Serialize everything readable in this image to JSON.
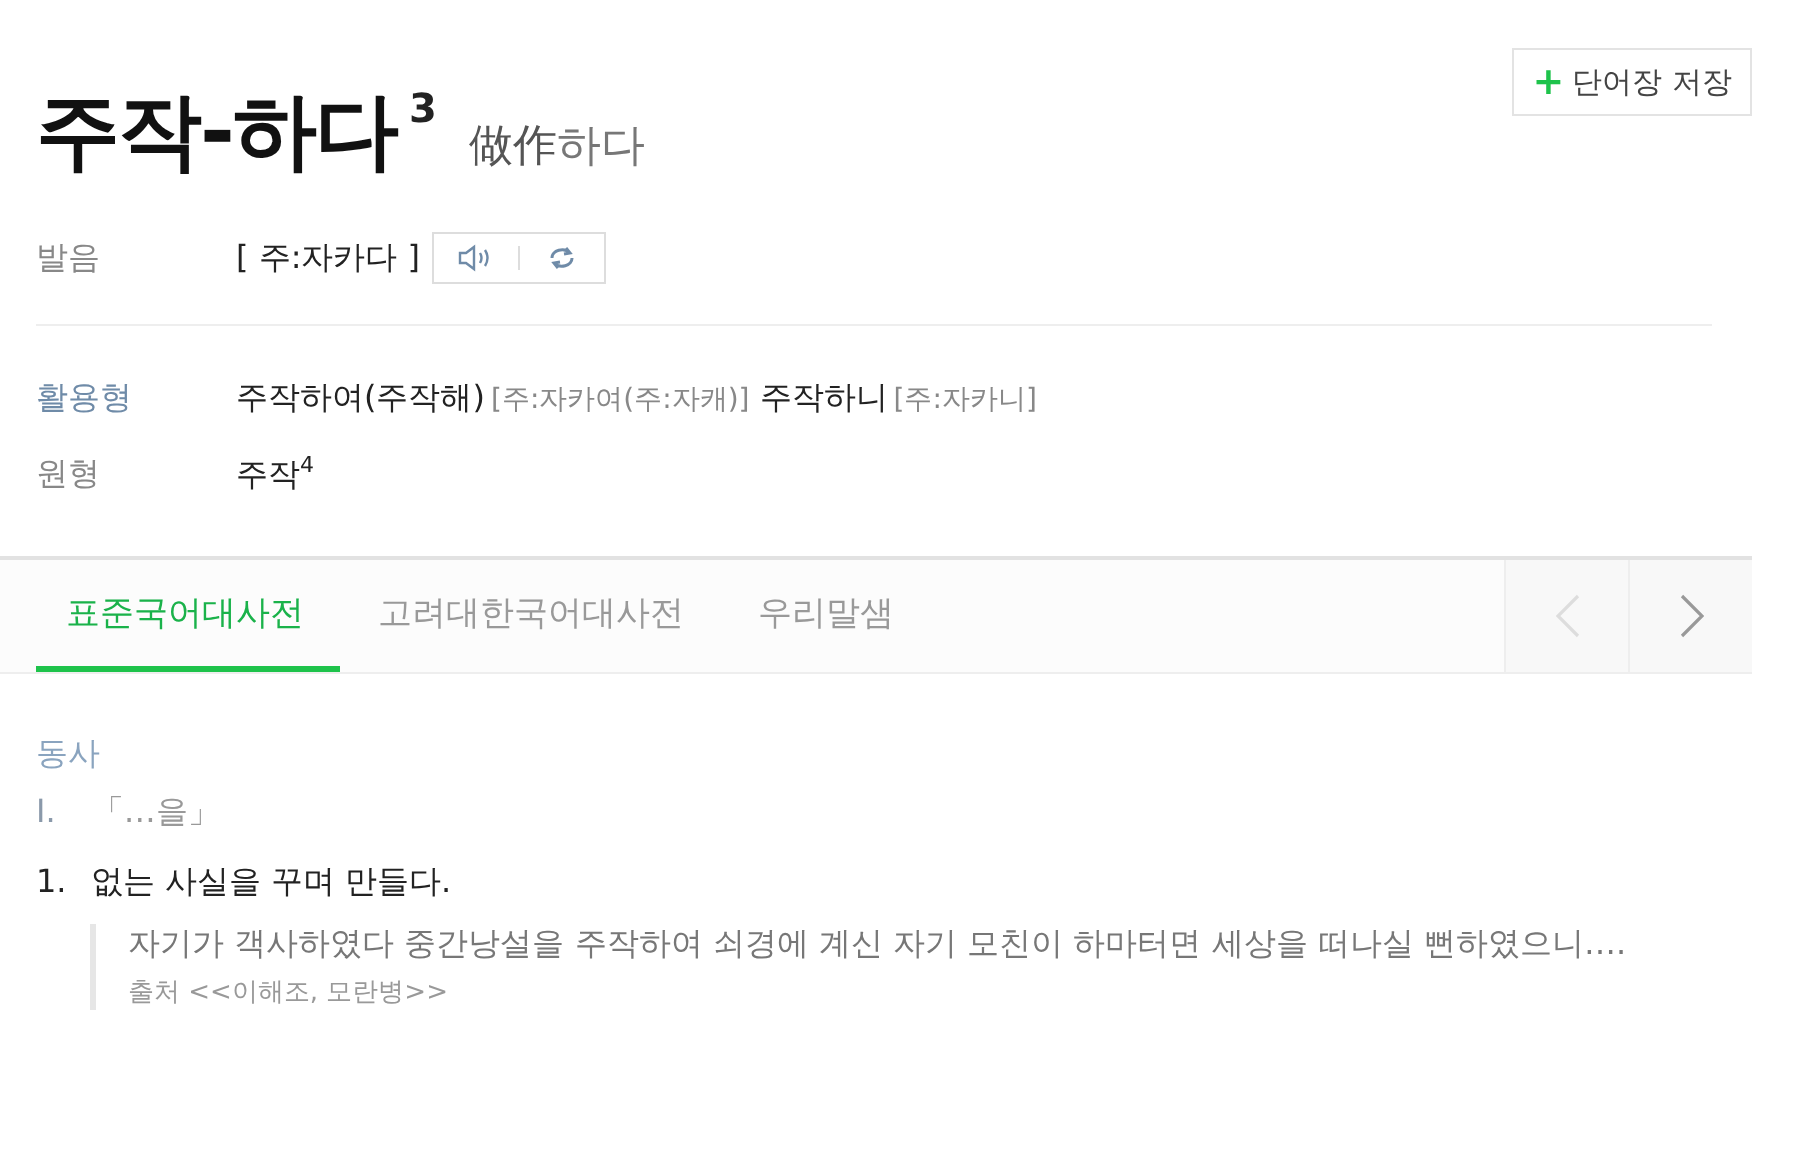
{
  "save_button": {
    "icon": "+",
    "label": "단어장 저장"
  },
  "headword": {
    "word": "주작-하다",
    "homograph": "3",
    "origin": {
      "hanja": "做作",
      "native": "하다"
    }
  },
  "pronunciation": {
    "label": "발음",
    "text": "[ 주:자카다 ]"
  },
  "inflections": {
    "label": "활용형",
    "items": [
      {
        "form": "주작하여(주작해)",
        "pron": "[주:자카여(주:자캐)]"
      },
      {
        "form": "주작하니",
        "pron": "[주:자카니]"
      }
    ]
  },
  "base_form": {
    "label": "원형",
    "word": "주작$^{4}$"
  },
  "tabs": [
    {
      "label": "표준국어대사전",
      "selected": true
    },
    {
      "label": "고려대한국어대사전",
      "selected": false
    },
    {
      "label": "우리말샘",
      "selected": false
    }
  ],
  "tab_nav": {
    "prev_disabled": true,
    "next_disabled": false
  },
  "entry": {
    "part_of_speech": "동사",
    "sense_group": {
      "number": "I.",
      "pattern": "「…을」"
    },
    "definitions": [
      {
        "number": "1.",
        "text": "없는 사실을 꾸며 만들다.",
        "example": "자기가 객사하였다 중간낭설을 주작하여 쇠경에 계신 자기 모친이 하마터면 세상을 떠나실 뻔하였으니….",
        "source": "출처 <<이해조, 모란병>>"
      }
    ]
  }
}
